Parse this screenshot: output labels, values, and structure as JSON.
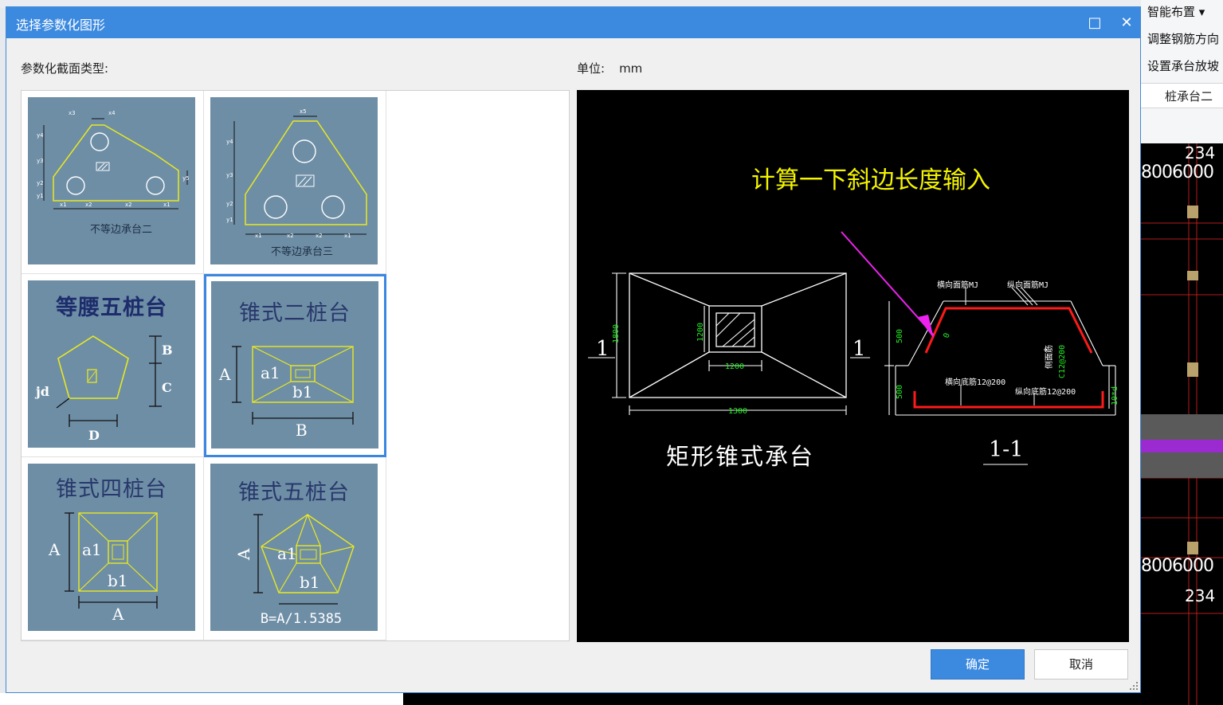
{
  "background_app": {
    "right_panel": {
      "items": [
        "智能布置",
        "调整钢筋方向",
        "设置承台放坡"
      ],
      "tab_label": "桩承台二",
      "cad_labels": [
        "234",
        "8006000",
        "8006000",
        "234"
      ]
    }
  },
  "dialog": {
    "title": "选择参数化图形",
    "maximize_glyph": "□",
    "close_glyph": "✕",
    "section_label": "参数化截面类型:",
    "unit_label": "单位:",
    "unit_value": "mm",
    "shapes": [
      {
        "name": "不等边承台二",
        "selected": false
      },
      {
        "name": "不等边承台三",
        "selected": false
      },
      {
        "name": "等腰五桩台",
        "selected": false
      },
      {
        "name": "锥式二桩台",
        "selected": true
      },
      {
        "name": "锥式四桩台",
        "selected": false
      },
      {
        "name": "锥式五桩台",
        "selected": false
      }
    ],
    "thumb_labels": {
      "shape1": {
        "dims": [
          "x3",
          "x4",
          "y4",
          "y3",
          "y2",
          "y1",
          "y5",
          "x1",
          "x2",
          "x2",
          "x1"
        ]
      },
      "shape2": {
        "dims": [
          "x5",
          "y4",
          "y3",
          "y2",
          "y1",
          "x1",
          "x2",
          "x2",
          "x1"
        ]
      },
      "shape3": {
        "dims": [
          "B",
          "C",
          "jd",
          "D"
        ]
      },
      "shape4": {
        "dims": [
          "A",
          "a1",
          "b1",
          "B"
        ]
      },
      "shape5": {
        "dims": [
          "A",
          "a1",
          "b1",
          "A"
        ]
      },
      "shape6": {
        "dims": [
          "A",
          "a1",
          "b1"
        ],
        "formula": "B=A/1.5385"
      }
    },
    "preview": {
      "annotation": "计算一下斜边长度输入",
      "plan_title": "矩形锥式承台",
      "section_title": "1-1",
      "cut_marks": [
        "1",
        "1"
      ],
      "plan_dims": [
        "1800",
        "1200",
        "1200",
        "1300"
      ],
      "section_notes": [
        "横向面筋MJ",
        "纵向面筋MJ",
        "侧面筋",
        "C12@200",
        "横向底筋12@200",
        "纵向底筋12@200",
        "500",
        "500",
        "10*d",
        "0"
      ]
    },
    "buttons": {
      "ok": "确定",
      "cancel": "取消"
    }
  },
  "colors": {
    "title_bar": "#3c8ae0",
    "thumb_bg": "#6e8ea6",
    "selection": "#3b86e0",
    "annotation": "#f5f500",
    "arrow": "#ee22ee",
    "rebar": "#ff1a1a",
    "dim_text": "#22ee22"
  },
  "icons": [
    "maximize-icon",
    "close-icon",
    "resize-grip-icon"
  ]
}
